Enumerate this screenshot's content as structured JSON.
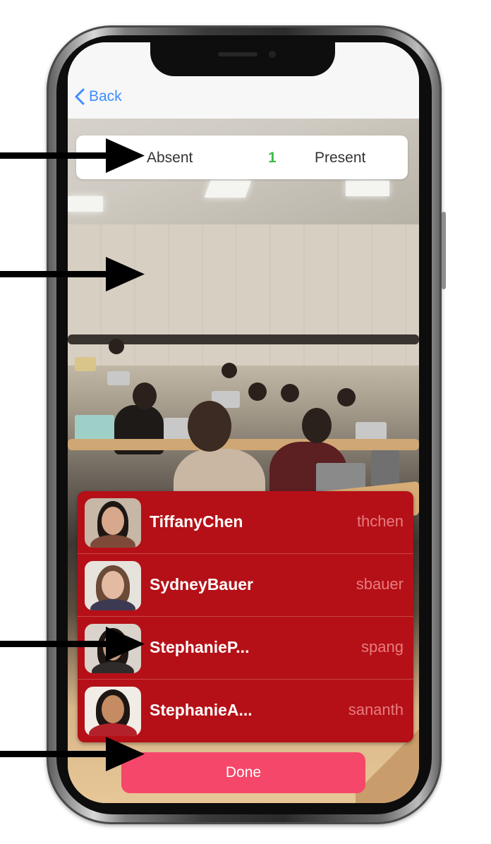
{
  "nav": {
    "back_label": "Back"
  },
  "attendance": {
    "absent_label": "Absent",
    "count": "1",
    "present_label": "Present"
  },
  "students": [
    {
      "name": "TiffanyChen",
      "username": "thchen"
    },
    {
      "name": "SydneyBauer",
      "username": "sbauer"
    },
    {
      "name": "StephanieP...",
      "username": "spang"
    },
    {
      "name": "StephanieA...",
      "username": "sananth"
    }
  ],
  "actions": {
    "done_label": "Done"
  },
  "colors": {
    "accent_blue": "#3f8cff",
    "present_count_green": "#3dbb48",
    "list_red": "#b51017",
    "username_pink": "#e77c80",
    "done_pink": "#f5476a"
  },
  "icons": [
    "chevron-left-icon",
    "annotation-arrow-icon"
  ]
}
